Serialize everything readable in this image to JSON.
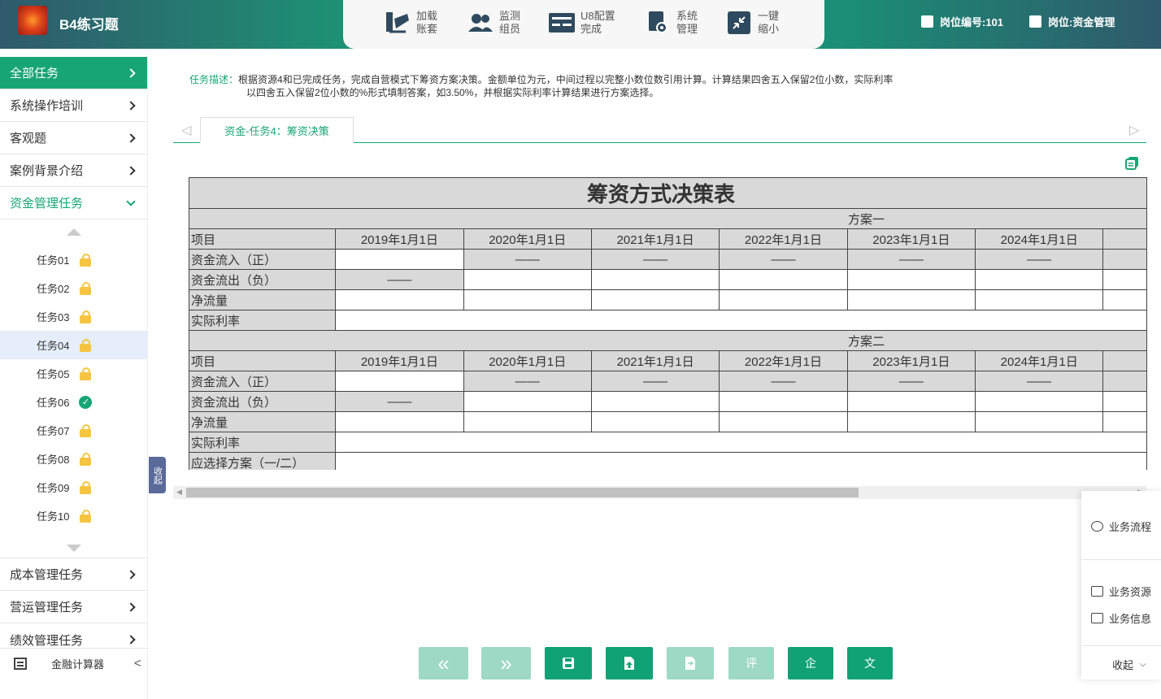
{
  "app": {
    "title": "B4练习题"
  },
  "toolbar": [
    {
      "label1": "加载",
      "label2": "账套",
      "icon": "load-ledger-icon"
    },
    {
      "label1": "监测",
      "label2": "组员",
      "icon": "monitor-members-icon"
    },
    {
      "label1": "U8配置",
      "label2": "完成",
      "icon": "u8-config-icon"
    },
    {
      "label1": "系统",
      "label2": "管理",
      "icon": "system-manage-icon"
    },
    {
      "label1": "一键",
      "label2": "缩小",
      "icon": "shrink-icon"
    }
  ],
  "header": {
    "post_no": "岗位编号:101",
    "post": "岗位:资金管理"
  },
  "sidebar": {
    "items_top": [
      "全部任务",
      "系统操作培训",
      "客观题",
      "案例背景介绍",
      "资金管理任务"
    ],
    "tasks": [
      {
        "label": "任务01",
        "status": "locked"
      },
      {
        "label": "任务02",
        "status": "locked"
      },
      {
        "label": "任务03",
        "status": "locked"
      },
      {
        "label": "任务04",
        "status": "locked"
      },
      {
        "label": "任务05",
        "status": "locked"
      },
      {
        "label": "任务06",
        "status": "done"
      },
      {
        "label": "任务07",
        "status": "locked"
      },
      {
        "label": "任务08",
        "status": "locked"
      },
      {
        "label": "任务09",
        "status": "locked"
      },
      {
        "label": "任务10",
        "status": "locked"
      }
    ],
    "items_bottom": [
      "成本管理任务",
      "营运管理任务",
      "绩效管理任务"
    ],
    "calculator": "金融计算器",
    "collapse": "收起"
  },
  "task": {
    "desc_label": "任务描述：",
    "desc_line1": "根据资源4和已完成任务，完成自营模式下筹资方案决策。金额单位为元，中间过程以完整小数位数引用计算。计算结果四舍五入保留2位小数，实际利率",
    "desc_line2": "以四舍五入保留2位小数的%形式填制答案，如3.50%，并根据实际利率计算结果进行方案选择。",
    "tab": "资金-任务4：筹资决策"
  },
  "sheet": {
    "title": "筹资方式决策表",
    "plan1": "方案一",
    "plan2": "方案二",
    "col_item": "项目",
    "dates": [
      "2019年1月1日",
      "2020年1月1日",
      "2021年1月1日",
      "2022年1月1日",
      "2023年1月1日",
      "2024年1月1日"
    ],
    "rows": [
      "资金流入（正）",
      "资金流出（负）",
      "净流量",
      "实际利率"
    ],
    "choose": "应选择方案（一/二）",
    "dash": "——"
  },
  "right_panel": {
    "flow": "业务流程",
    "resource": "业务资源",
    "info": "业务信息",
    "collapse": "收起"
  },
  "bottom_buttons": {
    "first": "«",
    "next": "»",
    "eval": "评",
    "enterprise": "企",
    "text": "文"
  },
  "colors": {
    "accent": "#18a576",
    "header_dark": "#2f5a6b"
  }
}
